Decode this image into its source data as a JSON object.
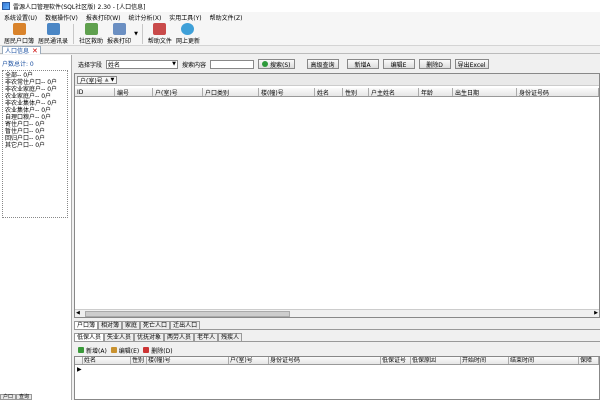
{
  "window": {
    "title": "雷源人口管理软件(SQL社区版) 2.30 - [人口信息]"
  },
  "menu": [
    "系统设置(U)",
    "数据操作(V)",
    "报表打印(W)",
    "统计分析(X)",
    "实用工具(Y)",
    "帮助文件(Z)"
  ],
  "toolbar": [
    {
      "label": "居民户口簿",
      "color": "#d9832b"
    },
    {
      "label": "居民通讯录",
      "color": "#4a86c5"
    },
    {
      "label": "社区救助",
      "color": "#5fa04e"
    },
    {
      "label": "报表打印",
      "color": "#6b8fc2"
    },
    {
      "label": "帮助文件",
      "color": "#c94a4a"
    },
    {
      "label": "网上更新",
      "color": "#3fa0d8"
    }
  ],
  "doc_tab": {
    "label": "人口信息"
  },
  "left_panel": {
    "header": "户数总计: 0",
    "tree": [
      "全部-- 0户",
      "  非农常住户口-- 0户",
      "  非农业家庭户-- 0户",
      "  农业家庭户-- 0户",
      "  非农业集体户-- 0户",
      "  农业集体户-- 0户",
      "  自理口粮户-- 0户",
      "  寄住户口-- 0户",
      "  暂住户口-- 0户",
      "  回归户口-- 0户",
      "  其它户口-- 0户"
    ],
    "bottom_tabs": [
      "户口",
      "查询"
    ]
  },
  "search": {
    "field_label": "选择字段",
    "field_value": "姓名",
    "content_label": "搜索内容",
    "content_value": "",
    "search_btn": "搜索(S)",
    "advanced_btn": "高级查询",
    "add_btn": "新增A",
    "edit_btn": "编辑E",
    "delete_btn": "删除D",
    "export_btn": "导出Excel"
  },
  "main_grid": {
    "group_chip": "户(室)号",
    "columns": [
      "ID",
      "编号",
      "户(室)号",
      "户口类别",
      "楼(幢)号",
      "姓名",
      "性别",
      "户主姓名",
      "年龄",
      "出生日期",
      "身份证号码"
    ]
  },
  "lower_tabs": [
    "户口簿",
    "相对簿",
    "家庭",
    "死亡人口",
    "迁出人口"
  ],
  "person_tabs": [
    "低保人员",
    "失业人员",
    "优抚对象",
    "两劳人员",
    "老年人",
    "残疾人"
  ],
  "actions": [
    {
      "label": "新增(A)",
      "color": "#3a9a3a"
    },
    {
      "label": "编辑(E)",
      "color": "#c9922f"
    },
    {
      "label": "删除(D)",
      "color": "#c33"
    }
  ],
  "sub_grid": {
    "columns": [
      "姓名",
      "性别",
      "楼(幢)号",
      "户(室)号",
      "身份证号码",
      "低保证号",
      "低保原因",
      "开始时间",
      "结束时间",
      "保障"
    ]
  }
}
